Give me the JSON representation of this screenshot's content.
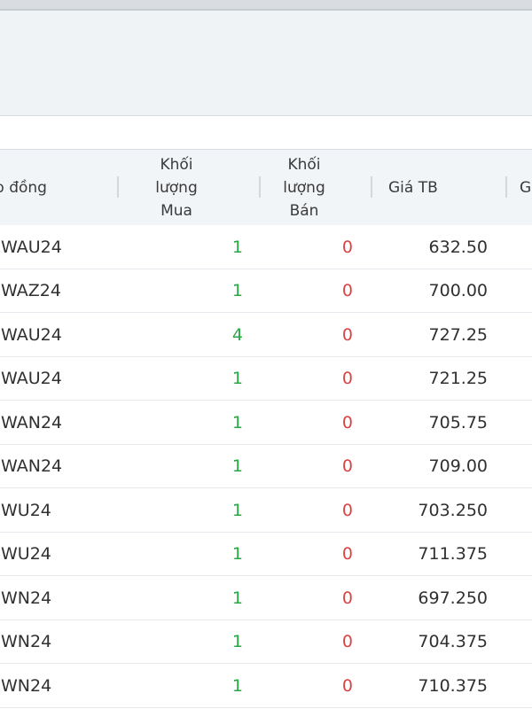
{
  "table": {
    "headers": {
      "contract": "p đồng",
      "buy_volume_lines": [
        "Khối",
        "lượng",
        "Mua"
      ],
      "sell_volume_lines": [
        "Khối",
        "lượng",
        "Bán"
      ],
      "average_price": "Giá TB",
      "next_column": "G"
    },
    "rows": [
      {
        "contract": "WAU24",
        "buy_volume": "1",
        "sell_volume": "0",
        "average_price": "632.50"
      },
      {
        "contract": "WAZ24",
        "buy_volume": "1",
        "sell_volume": "0",
        "average_price": "700.00"
      },
      {
        "contract": "WAU24",
        "buy_volume": "4",
        "sell_volume": "0",
        "average_price": "727.25"
      },
      {
        "contract": "WAU24",
        "buy_volume": "1",
        "sell_volume": "0",
        "average_price": "721.25"
      },
      {
        "contract": "WAN24",
        "buy_volume": "1",
        "sell_volume": "0",
        "average_price": "705.75"
      },
      {
        "contract": "WAN24",
        "buy_volume": "1",
        "sell_volume": "0",
        "average_price": "709.00"
      },
      {
        "contract": "WU24",
        "buy_volume": "1",
        "sell_volume": "0",
        "average_price": "703.250"
      },
      {
        "contract": "WU24",
        "buy_volume": "1",
        "sell_volume": "0",
        "average_price": "711.375"
      },
      {
        "contract": "WN24",
        "buy_volume": "1",
        "sell_volume": "0",
        "average_price": "697.250"
      },
      {
        "contract": "WN24",
        "buy_volume": "1",
        "sell_volume": "0",
        "average_price": "704.375"
      },
      {
        "contract": "WN24",
        "buy_volume": "1",
        "sell_volume": "0",
        "average_price": "710.375"
      }
    ]
  },
  "colors": {
    "buy_volume": "#28a745",
    "sell_volume": "#d64545",
    "header_background": "#f2f5f8",
    "panel_background": "#eff3f6"
  }
}
